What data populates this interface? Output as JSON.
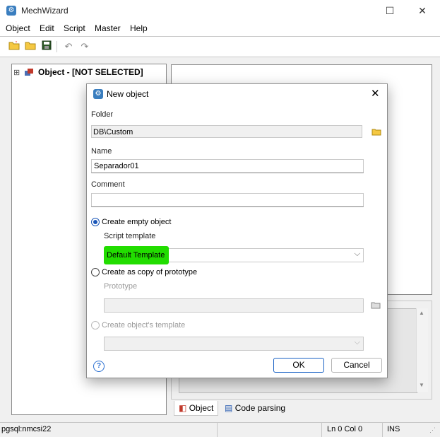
{
  "app": {
    "title": "MechWizard",
    "icon": "gear-app-icon"
  },
  "window_controls": {
    "maximize": "☐",
    "close": "✕"
  },
  "menu": [
    "Object",
    "Edit",
    "Script",
    "Master",
    "Help"
  ],
  "tree": {
    "expander": "⊞",
    "label": "Object - [NOT SELECTED]"
  },
  "tabs": [
    "Object",
    "Code parsing"
  ],
  "status": {
    "db": "pgsql:nmcsi22",
    "position": "Ln 0 Col 0",
    "mode": "INS"
  },
  "dialog": {
    "title": "New object",
    "folder": {
      "label": "Folder",
      "value": "DB\\Custom"
    },
    "name": {
      "label": "Name",
      "value": "Separador01"
    },
    "comment": {
      "label": "Comment",
      "value": ""
    },
    "option_empty": {
      "label": "Create empty object",
      "checked": true
    },
    "script_template": {
      "label": "Script template",
      "value": "Default Template",
      "highlight": "#22dd00"
    },
    "option_copy": {
      "label": "Create as copy of prototype",
      "checked": false
    },
    "prototype": {
      "label": "Prototype",
      "value": ""
    },
    "option_template": {
      "label": "Create object's template",
      "checked": false,
      "value": ""
    },
    "help": "?",
    "ok": "OK",
    "cancel": "Cancel"
  }
}
